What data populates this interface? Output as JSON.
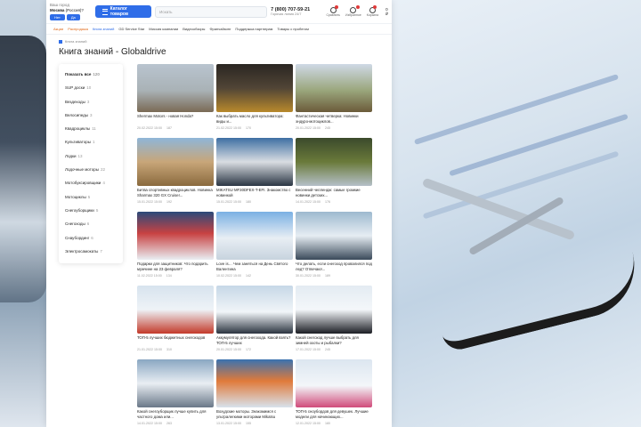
{
  "header": {
    "city_label": "Ваш город",
    "city_value": "Москва",
    "city_question": "(Россия)?",
    "city_yes": "Нет",
    "city_no": "Да",
    "catalog_label": "Каталог товаров",
    "search_placeholder": "Искать",
    "phone": "7 (800) 707-59-21",
    "phone_note": "Горячая линия 24/7",
    "icons": [
      {
        "label": "Сравнить",
        "icon": "compare-icon"
      },
      {
        "label": "Избранное",
        "icon": "heart-icon"
      },
      {
        "label": "Корзина",
        "icon": "cart-icon"
      }
    ],
    "cart_total": "0 ₽"
  },
  "nav": [
    "Акции",
    "Распродажа",
    "Книга знаний",
    "GD Service Star",
    "Миссия компании",
    "Видеообзоры",
    "Франчайзинг",
    "Поддержка партнерам",
    "Товары с пробегом"
  ],
  "breadcrumb": "Книга знаний",
  "title": "Книга знаний - Globaldrive",
  "sidebar": [
    {
      "label": "Показать все",
      "count": "120"
    },
    {
      "label": "SUP доски",
      "count": "10"
    },
    {
      "label": "Вездеходы",
      "count": "3"
    },
    {
      "label": "Велосипеды",
      "count": "3"
    },
    {
      "label": "Квадроциклы",
      "count": "11"
    },
    {
      "label": "Культиваторы",
      "count": "1"
    },
    {
      "label": "Лодки",
      "count": "13"
    },
    {
      "label": "Лодочные моторы",
      "count": "22"
    },
    {
      "label": "Мотобуксировщики",
      "count": "4"
    },
    {
      "label": "Мотоциклы",
      "count": "5"
    },
    {
      "label": "Снегоуборщики",
      "count": "5"
    },
    {
      "label": "Снегоходы",
      "count": "6"
    },
    {
      "label": "Снаубординг",
      "count": "6"
    },
    {
      "label": "Электросамокаты",
      "count": "7"
    }
  ],
  "articles": [
    {
      "title": "Shermax Motors - новая Honda?",
      "date": "20.02.2022 15:00",
      "views": "187"
    },
    {
      "title": "Как выбрать масло для культиватора: виды и...",
      "date": "21.02.2022 15:00",
      "views": "170"
    },
    {
      "title": "Фантастическая четверка: Новинки эндуро-мотоциклов...",
      "date": "20.01.2022 15:00",
      "views": "245"
    },
    {
      "title": "Битва спортивных квадроциклов. Новинка Sharmax 320 GX Cruiser...",
      "date": "15.01.2022 15:00",
      "views": "192"
    },
    {
      "title": "MIKATSU MF30DFEX-T-EFI. Знакомство с новинкой",
      "date": "15.01.2022 15:00",
      "views": "180"
    },
    {
      "title": "Весенний челлендж: самые громкие новинки детских...",
      "date": "14.01.2022 15:00",
      "views": "176"
    },
    {
      "title": "Подарки для защитников: Что подарить мужчине на 23 февраля?",
      "date": "11.02.2022 15:00",
      "views": "134"
    },
    {
      "title": "Love is… Чем заняться на День Святого Валентина",
      "date": "10.02.2022 15:00",
      "views": "142"
    },
    {
      "title": "Что делать, если снегоход провалился под лед? Отвечаю!...",
      "date": "30.01.2022 15:00",
      "views": "189"
    },
    {
      "title": "ТОП-5 лучших бюджетных снегоходов",
      "date": "21.01.2022 15:00",
      "views": "310"
    },
    {
      "title": "Аккумулятор для снегохода. Какой взять? ТОП-5 лучших",
      "date": "20.01.2022 15:00",
      "views": "172"
    },
    {
      "title": "Какой снегоход лучше выбрать для зимней охоты и рыбалки?",
      "date": "17.01.2022 15:00",
      "views": "245"
    },
    {
      "title": "Какой снегоуборщик лучше купить для частного дома или...",
      "date": "14.01.2022 15:00",
      "views": "263"
    },
    {
      "title": "Вохудские моторы. Знакомимся с ультралегкими моторами Mikatsu",
      "date": "13.01.2022 15:00",
      "views": "155"
    },
    {
      "title": "ТОП-5 сноубордов для девушек. Лучшие модели для начинающих...",
      "date": "12.01.2022 15:00",
      "views": "180"
    }
  ],
  "colors": {
    "accent": "#2f6de8",
    "badge": "#e03a3a"
  }
}
